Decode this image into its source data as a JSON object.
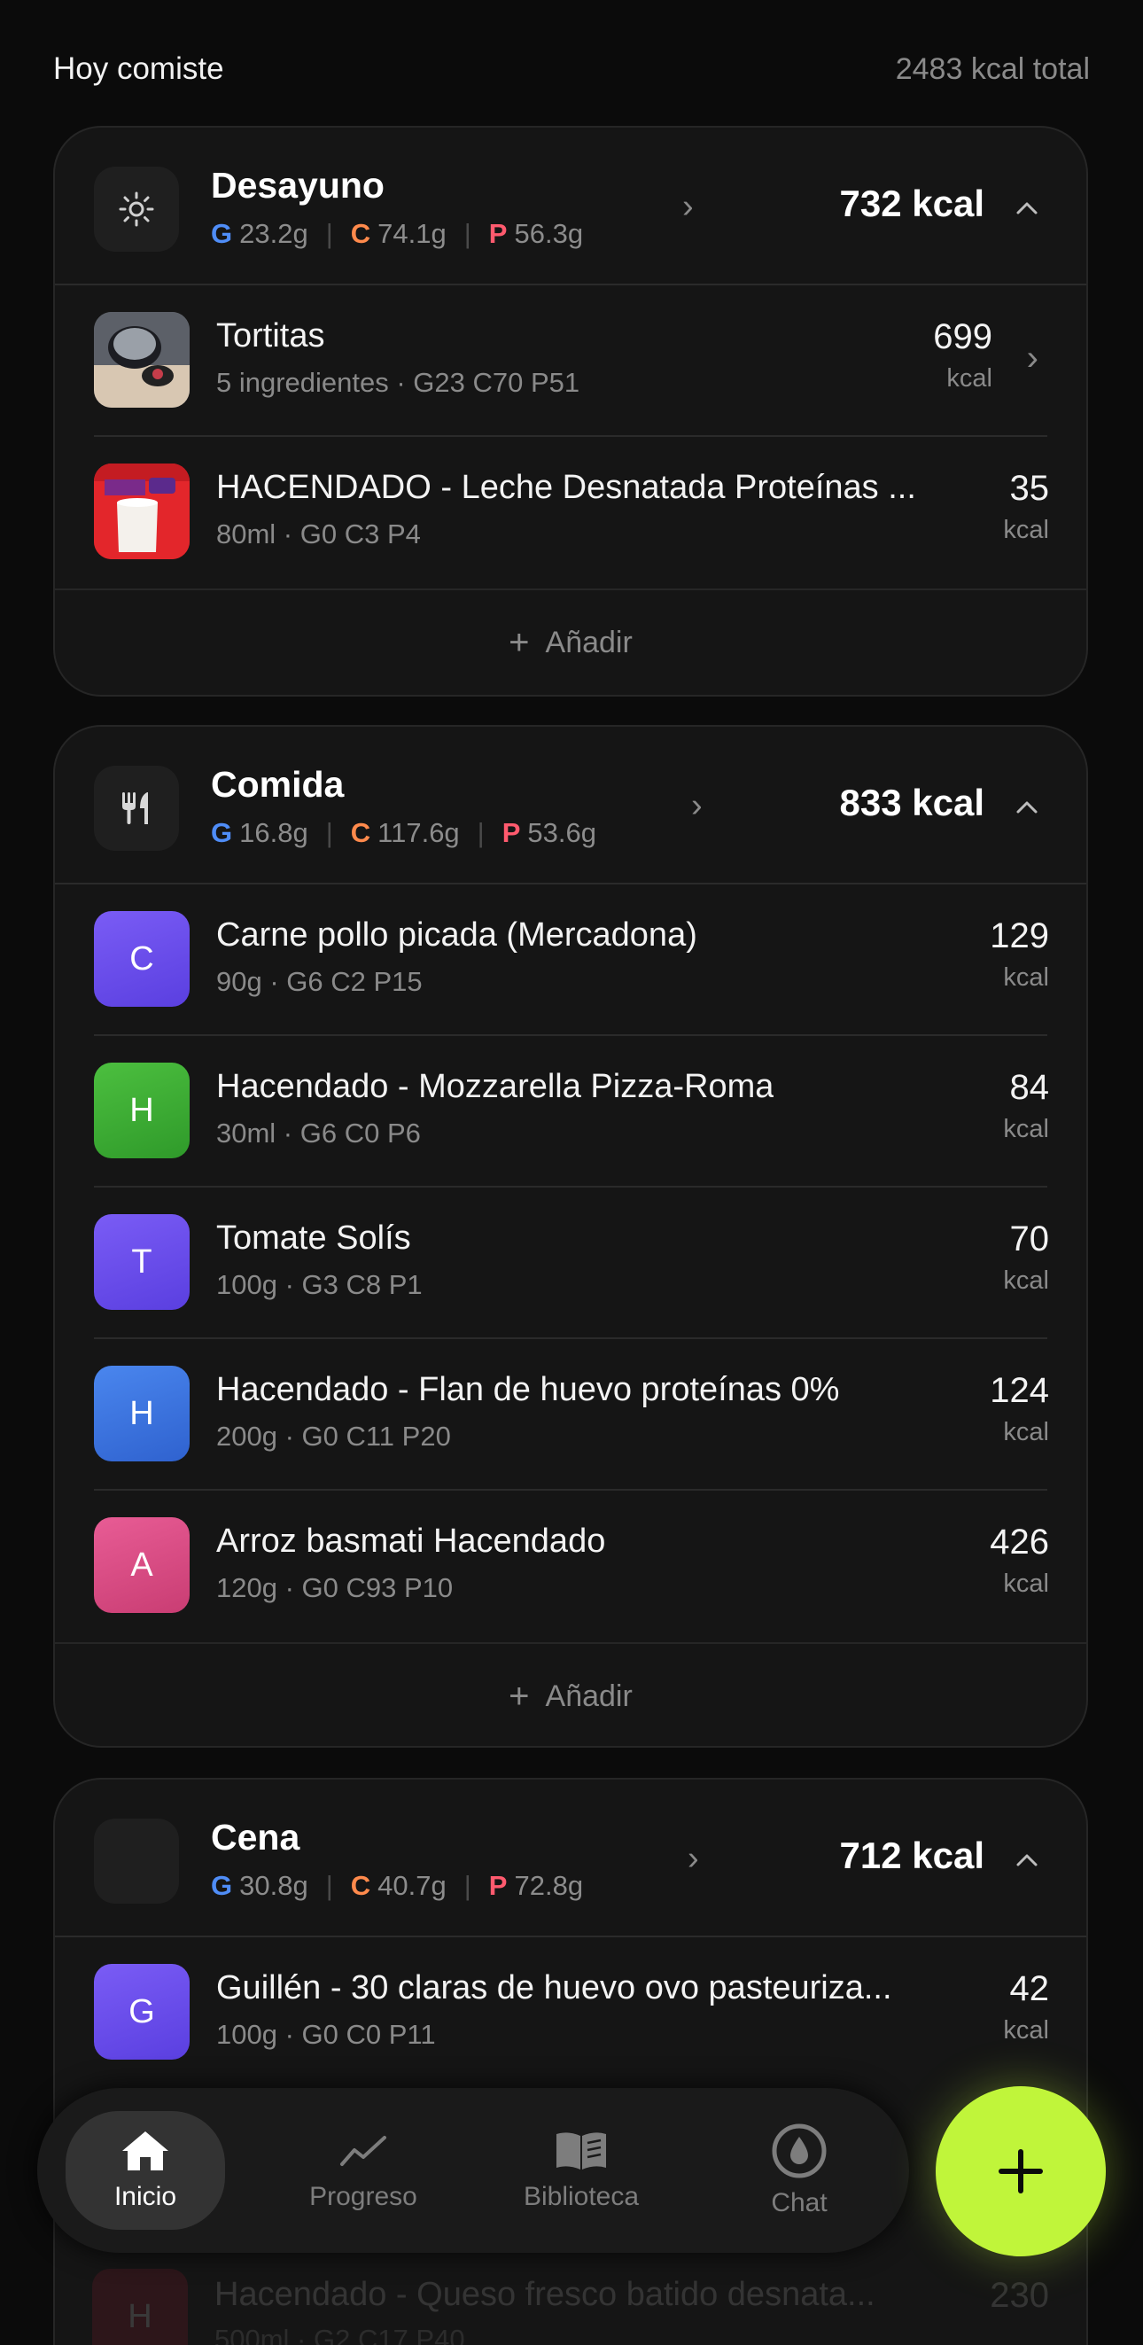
{
  "header": {
    "title": "Hoy comiste",
    "total": "2483 kcal total"
  },
  "meals": [
    {
      "name": "Desayuno",
      "icon": "sun-icon",
      "g": "23.2g",
      "c": "74.1g",
      "p": "56.3g",
      "kcal": "732 kcal",
      "items": [
        {
          "name": "Tortitas",
          "sub": "5 ingredientes · G23 C70 P51",
          "kcal": "699",
          "unit": "kcal",
          "thumb": "photo-pan"
        },
        {
          "name": "HACENDADO - Leche Desnatada Proteínas ...",
          "sub": "80ml · G0 C3 P4",
          "kcal": "35",
          "unit": "kcal",
          "thumb": "photo-milk"
        }
      ],
      "add_label": "Añadir"
    },
    {
      "name": "Comida",
      "icon": "fork-knife-icon",
      "g": "16.8g",
      "c": "117.6g",
      "p": "53.6g",
      "kcal": "833 kcal",
      "items": [
        {
          "name": "Carne pollo picada (Mercadona)",
          "sub": "90g · G6 C2 P15",
          "kcal": "129",
          "unit": "kcal",
          "letter": "C",
          "color": "#6a4cf0"
        },
        {
          "name": "Hacendado - Mozzarella Pizza-Roma",
          "sub": "30ml · G6 C0 P6",
          "kcal": "84",
          "unit": "kcal",
          "letter": "H",
          "color": "#3fa836"
        },
        {
          "name": "Tomate Solís",
          "sub": "100g · G3 C8 P1",
          "kcal": "70",
          "unit": "kcal",
          "letter": "T",
          "color": "#6a4cf0"
        },
        {
          "name": "Hacendado - Flan de huevo proteínas 0%",
          "sub": "200g · G0 C11 P20",
          "kcal": "124",
          "unit": "kcal",
          "letter": "H",
          "color": "#3a72e0"
        },
        {
          "name": "Arroz basmati Hacendado",
          "sub": "120g · G0 C93 P10",
          "kcal": "426",
          "unit": "kcal",
          "letter": "A",
          "color": "#dc4b86"
        }
      ],
      "add_label": "Añadir"
    },
    {
      "name": "Cena",
      "icon": "moon-icon",
      "g": "30.8g",
      "c": "40.7g",
      "p": "72.8g",
      "kcal": "712 kcal",
      "items": [
        {
          "name": "Guillén - 30 claras de huevo ovo pasteuriza...",
          "sub": "100g · G0 C0 P11",
          "kcal": "42",
          "unit": "kcal",
          "letter": "G",
          "color": "#6a4cf0"
        }
      ]
    }
  ],
  "macro_letters": {
    "g": "G",
    "c": "C",
    "p": "P"
  },
  "ghost_item": {
    "name": "Hacendado - Queso fresco batido desnata...",
    "sub": "500ml · G2 C17 P40",
    "kcal": "230",
    "letter": "H"
  },
  "nav": [
    {
      "label": "Inicio",
      "icon": "home-icon",
      "active": true
    },
    {
      "label": "Progreso",
      "icon": "trend-icon"
    },
    {
      "label": "Biblioteca",
      "icon": "book-icon"
    },
    {
      "label": "Chat",
      "icon": "chat-drop-icon"
    }
  ],
  "colors": {
    "accent": "#c0f53a",
    "fat": "#4f8df7",
    "carb": "#ff8a4c",
    "protein": "#ff5a6e"
  }
}
